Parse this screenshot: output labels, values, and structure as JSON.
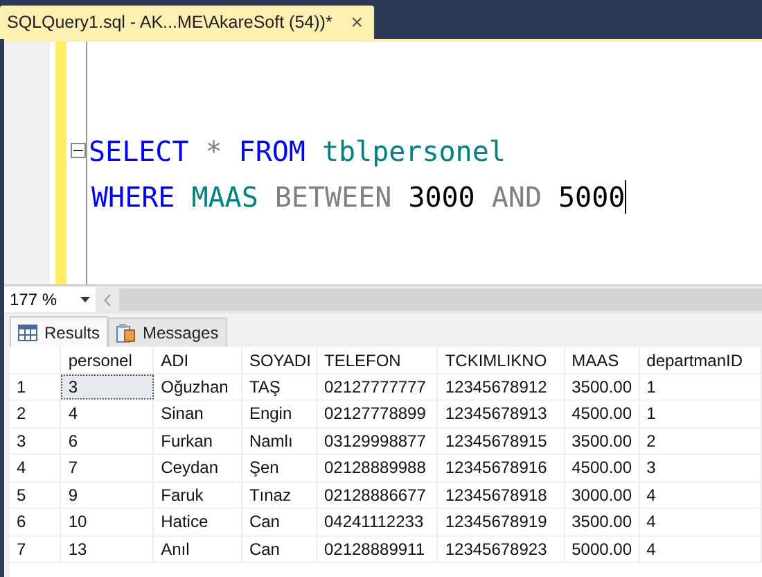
{
  "document_tab": {
    "title": "SQLQuery1.sql - AK...ME\\AkareSoft (54))*",
    "close": "×"
  },
  "editor": {
    "lines": [
      {
        "collapse": true,
        "tokens": [
          {
            "kind": "keyword",
            "text": "SELECT"
          },
          {
            "kind": "operator",
            "text": "*"
          },
          {
            "kind": "keyword",
            "text": "FROM"
          },
          {
            "kind": "identifier",
            "text": "tblpersonel"
          }
        ]
      },
      {
        "collapse": false,
        "tokens": [
          {
            "kind": "keyword",
            "text": "WHERE"
          },
          {
            "kind": "identifier",
            "text": "MAAS"
          },
          {
            "kind": "operator",
            "text": "BETWEEN"
          },
          {
            "kind": "number",
            "text": "3000"
          },
          {
            "kind": "operator",
            "text": "AND"
          },
          {
            "kind": "number",
            "text": "5000"
          }
        ]
      }
    ]
  },
  "zoom": {
    "value": "177 %"
  },
  "result_tabs": [
    {
      "label": "Results",
      "kind": "grid",
      "selected": true
    },
    {
      "label": "Messages",
      "kind": "messages",
      "selected": false
    }
  ],
  "table": {
    "columns": [
      "personel",
      "ADI",
      "SOYADI",
      "TELEFON",
      "TCKIMLIKNO",
      "MAAS",
      "departmanID"
    ],
    "rows": [
      {
        "number": "1",
        "focused": true,
        "cells": [
          "3",
          "Oğuzhan",
          "TAŞ",
          "02127777777",
          "12345678912",
          "3500.00",
          "1"
        ]
      },
      {
        "number": "2",
        "focused": false,
        "cells": [
          "4",
          "Sinan",
          "Engin",
          "02127778899",
          "12345678913",
          "4500.00",
          "1"
        ]
      },
      {
        "number": "3",
        "focused": false,
        "cells": [
          "6",
          "Furkan",
          "Namlı",
          "03129998877",
          "12345678915",
          "3500.00",
          "2"
        ]
      },
      {
        "number": "4",
        "focused": false,
        "cells": [
          "7",
          "Ceydan",
          "Şen",
          "02128889988",
          "12345678916",
          "4500.00",
          "3"
        ]
      },
      {
        "number": "5",
        "focused": false,
        "cells": [
          "9",
          "Faruk",
          "Tınaz",
          "02128886677",
          "12345678918",
          "3000.00",
          "4"
        ]
      },
      {
        "number": "6",
        "focused": false,
        "cells": [
          "10",
          "Hatice",
          "Can",
          "04241112233",
          "12345678919",
          "3500.00",
          "4"
        ]
      },
      {
        "number": "7",
        "focused": false,
        "cells": [
          "13",
          "Anıl",
          "Can",
          "02128889911",
          "12345678923",
          "5000.00",
          "4"
        ]
      }
    ]
  }
}
